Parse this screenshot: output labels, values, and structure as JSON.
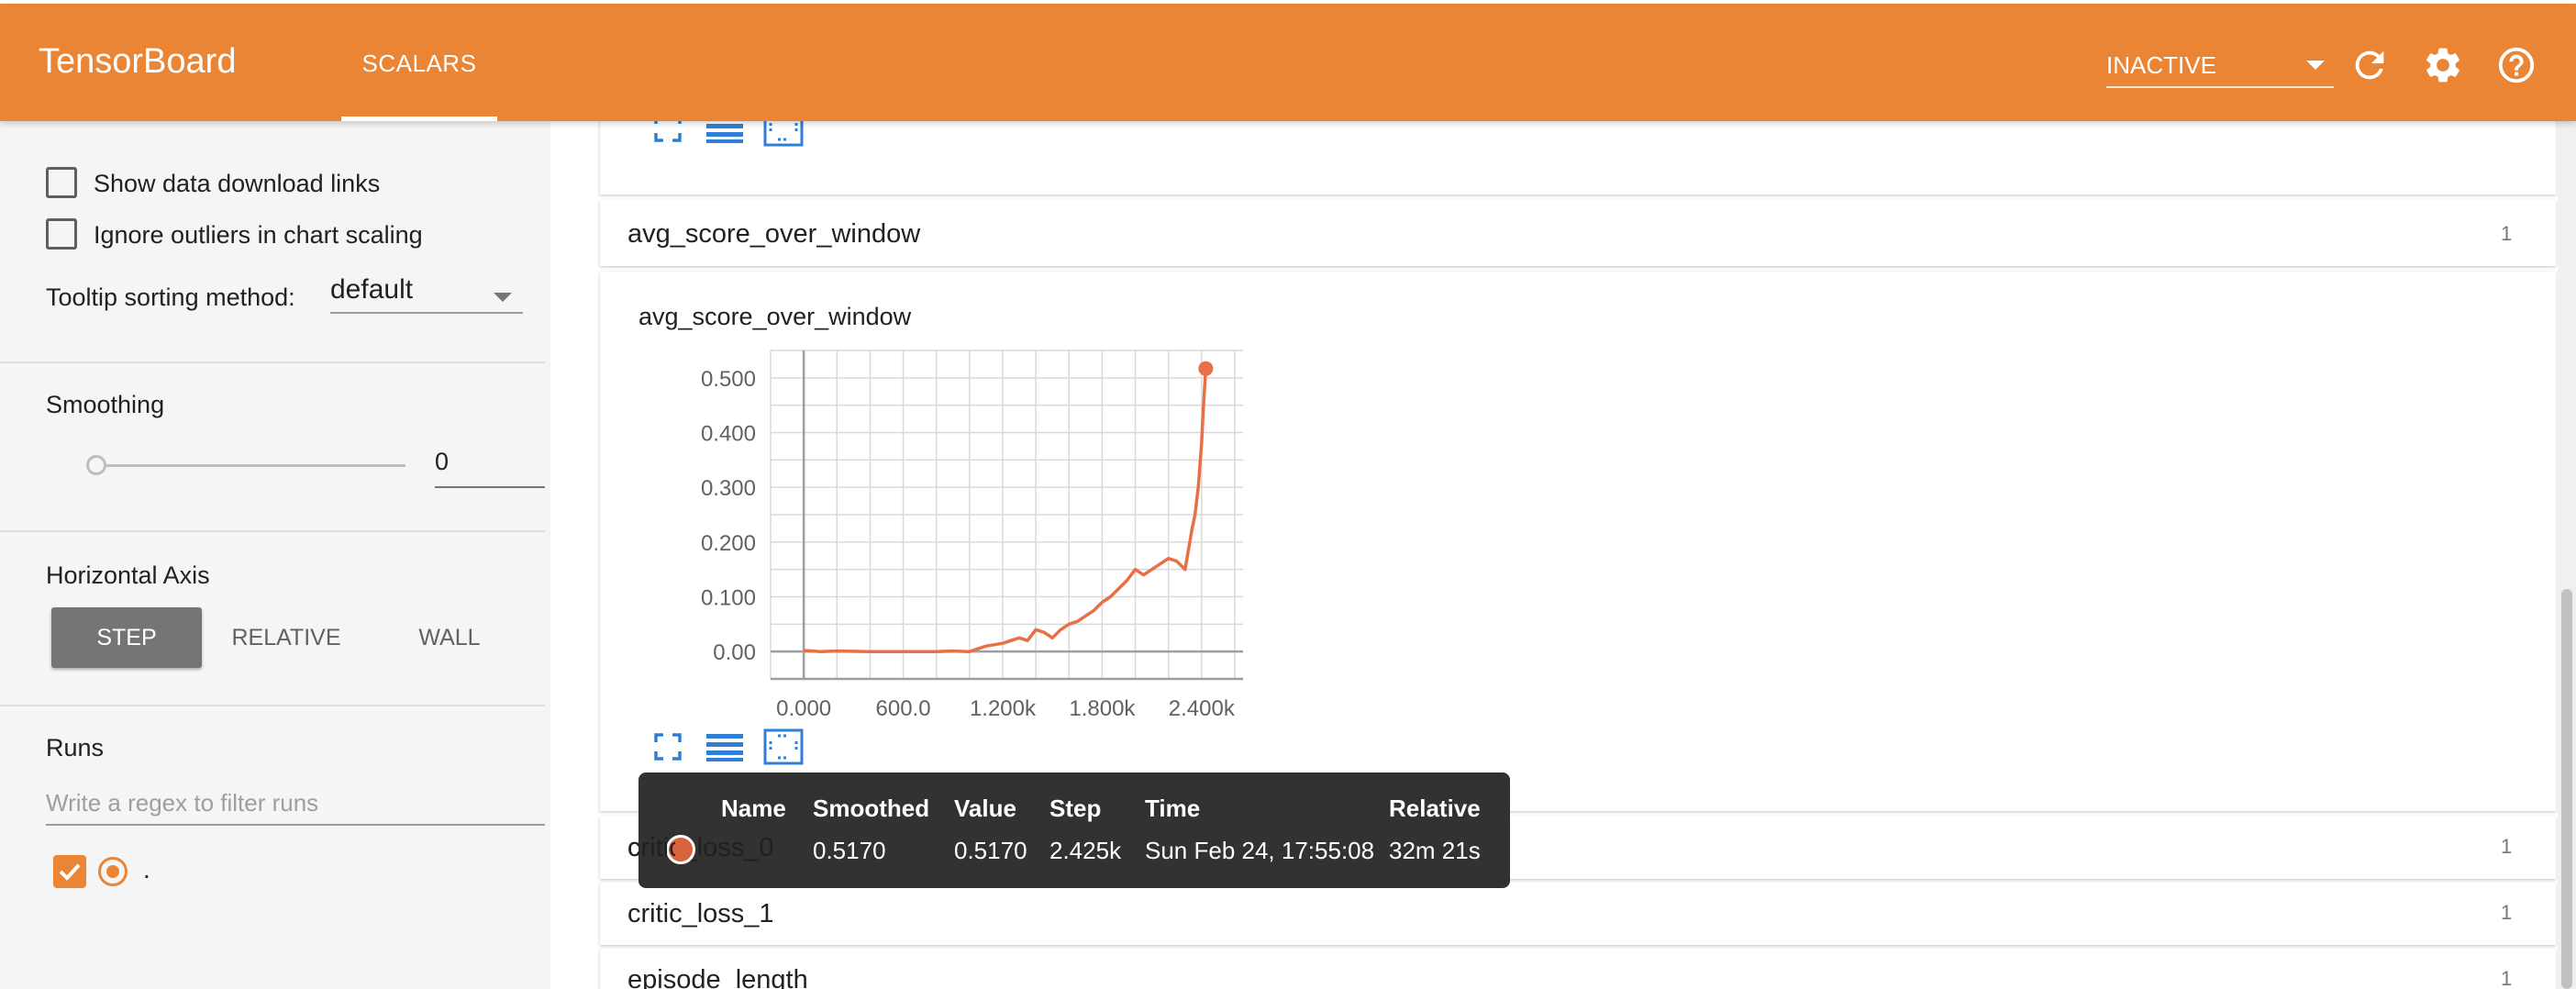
{
  "header": {
    "brand": "TensorBoard",
    "active_tab": "SCALARS",
    "status_select": "INACTIVE",
    "icons": [
      "refresh-icon",
      "settings-icon",
      "help-icon"
    ]
  },
  "sidebar": {
    "show_download_links": "Show data download links",
    "ignore_outliers": "Ignore outliers in chart scaling",
    "tooltip_sorting_label": "Tooltip sorting method:",
    "tooltip_sorting_value": "default",
    "smoothing_title": "Smoothing",
    "smoothing_value": "0",
    "horizontal_axis_title": "Horizontal Axis",
    "axis_buttons": [
      "STEP",
      "RELATIVE",
      "WALL"
    ],
    "axis_active": "STEP",
    "runs_title": "Runs",
    "runs_filter_placeholder": "Write a regex to filter runs",
    "run_name": "."
  },
  "categories": [
    {
      "name": "avg_score_over_window",
      "count": "1"
    },
    {
      "name": "critic_loss_0",
      "count": "1"
    },
    {
      "name": "critic_loss_1",
      "count": "1"
    },
    {
      "name": "episode_length",
      "count": "1"
    }
  ],
  "chart_title": "avg_score_over_window",
  "chart_data": {
    "type": "line",
    "title": "avg_score_over_window",
    "xlabel": "",
    "ylabel": "",
    "x_ticks": [
      "0.000",
      "600.0",
      "1.200k",
      "1.800k",
      "2.400k"
    ],
    "y_ticks": [
      "0.00",
      "0.100",
      "0.200",
      "0.300",
      "0.400",
      "0.500"
    ],
    "xlim": [
      -200,
      2650
    ],
    "ylim": [
      -0.05,
      0.55
    ],
    "grid": true,
    "series": [
      {
        "color": "#e86f46",
        "x": [
          0,
          100,
          200,
          400,
          600,
          800,
          900,
          1000,
          1100,
          1200,
          1250,
          1300,
          1350,
          1400,
          1450,
          1500,
          1550,
          1600,
          1650,
          1700,
          1750,
          1800,
          1850,
          1900,
          1950,
          2000,
          2050,
          2100,
          2150,
          2200,
          2250,
          2300,
          2340,
          2360,
          2380,
          2400,
          2410,
          2420,
          2425
        ],
        "y": [
          0.002,
          0.0,
          0.001,
          0.0,
          0.0,
          0.0,
          0.001,
          0.0,
          0.01,
          0.015,
          0.02,
          0.025,
          0.02,
          0.04,
          0.035,
          0.025,
          0.04,
          0.05,
          0.055,
          0.065,
          0.075,
          0.09,
          0.1,
          0.115,
          0.13,
          0.15,
          0.14,
          0.15,
          0.16,
          0.17,
          0.165,
          0.15,
          0.22,
          0.25,
          0.3,
          0.38,
          0.44,
          0.49,
          0.517
        ]
      }
    ],
    "highlight": {
      "x": 2425,
      "y": 0.517
    }
  },
  "tooltip": {
    "headers": [
      "Name",
      "Smoothed",
      "Value",
      "Step",
      "Time",
      "Relative"
    ],
    "row": [
      "critic_loss_0",
      "0.5170",
      "0.5170",
      "2.425k",
      "Sun Feb 24, 17:55:08",
      "32m 21s"
    ]
  },
  "colors": {
    "brand": "#e98534",
    "line": "#e86f46"
  }
}
